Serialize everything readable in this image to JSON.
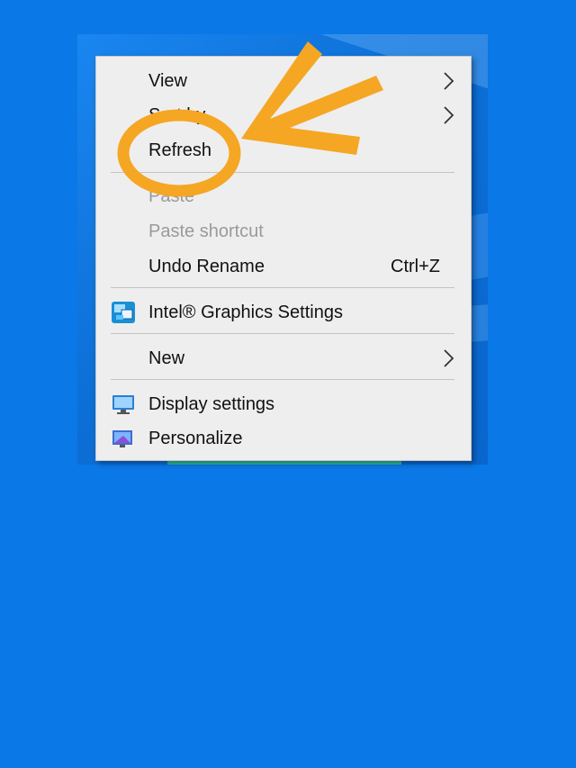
{
  "menu": {
    "view": "View",
    "sort_by": "Sort by",
    "refresh": "Refresh",
    "paste": "Paste",
    "paste_shortcut": "Paste shortcut",
    "undo_rename": "Undo Rename",
    "undo_rename_shortcut": "Ctrl+Z",
    "intel_graphics": "Intel® Graphics Settings",
    "new": "New",
    "display_settings": "Display settings",
    "personalize": "Personalize"
  },
  "icons": {
    "submenu": "chevron-right-icon",
    "intel": "intel-graphics-icon",
    "display": "monitor-icon",
    "personalize": "personalize-icon"
  },
  "colors": {
    "desktop": "#0a78e6",
    "menu_background": "#eeeeee",
    "annotation": "#f5a623",
    "disabled_text": "#9a9a9a"
  }
}
